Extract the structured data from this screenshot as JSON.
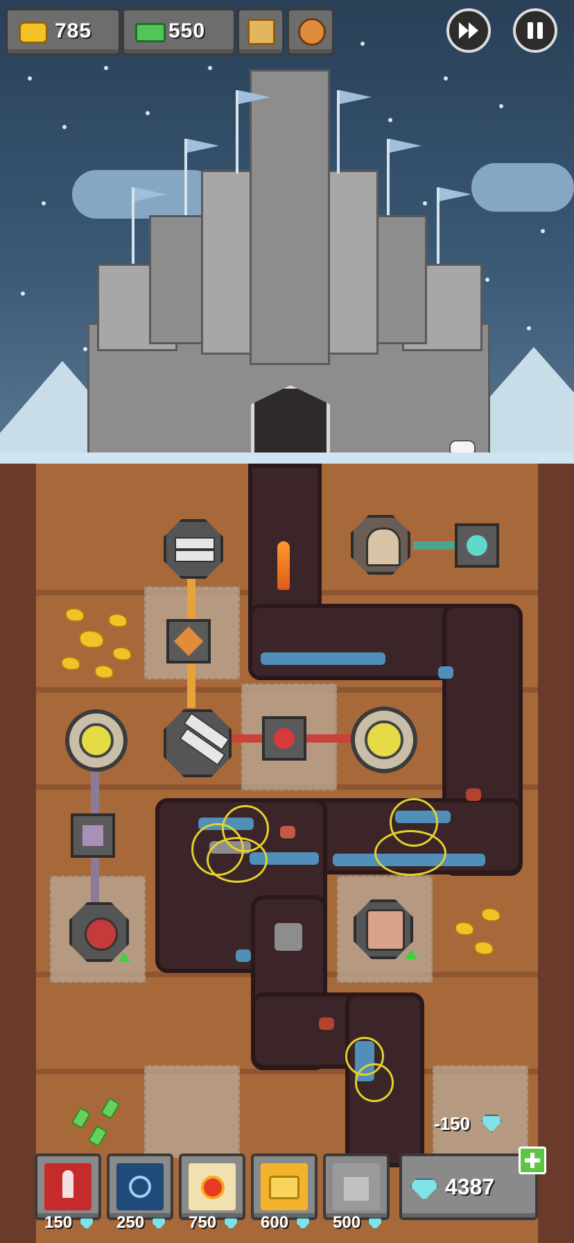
{
  "hud": {
    "coins": "785",
    "cash": "550",
    "map_icon": "map-icon",
    "skull_icon": "skull-icon",
    "fast_forward_icon": "fast-forward-icon",
    "pause_icon": "pause-icon"
  },
  "field": {
    "deduction_label": "-150"
  },
  "shop": {
    "items": [
      {
        "name": "rocket",
        "cost": "150",
        "icon": "rocket-icon"
      },
      {
        "name": "freeze",
        "cost": "250",
        "icon": "snowflake-icon"
      },
      {
        "name": "fireball",
        "cost": "750",
        "icon": "fireball-icon"
      },
      {
        "name": "gold-chest",
        "cost": "600",
        "icon": "chest-icon"
      },
      {
        "name": "fortress",
        "cost": "500",
        "icon": "castle-icon"
      }
    ],
    "diamonds": "4387",
    "add_icon": "plus-icon"
  },
  "colors": {
    "sky": "#2f4a63",
    "dirt": "#a8693a",
    "tunnel": "#3b2529",
    "accent_gold": "#f3c227",
    "diamond": "#7ee2e6"
  }
}
